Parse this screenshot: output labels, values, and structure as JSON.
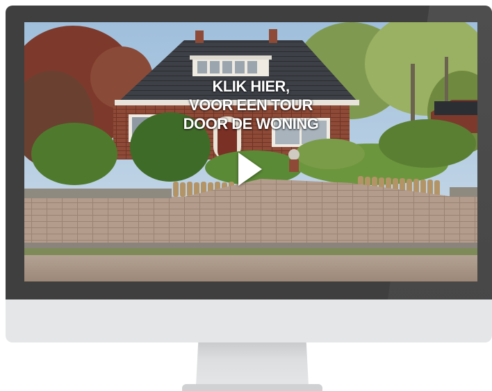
{
  "video": {
    "cta_lines": [
      "KLIK HIER,",
      "VOOR EEN TOUR",
      "DOOR DE WONING"
    ],
    "play_icon": "play-icon"
  },
  "colors": {
    "bezel": "#3f3f3f",
    "chin": "#e4e6e8",
    "stand": "#d8dadc",
    "cta_text": "#ffffff"
  }
}
